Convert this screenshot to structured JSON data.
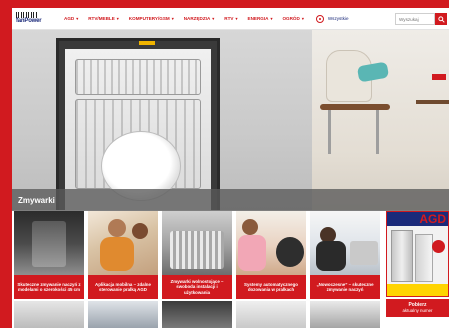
{
  "header": {
    "logo_text": "fanPower",
    "nav_items": [
      {
        "label": "AGD"
      },
      {
        "label": "RTV/MEBLE"
      },
      {
        "label": "KOMPUTERY/GSM"
      },
      {
        "label": "NARZĘDZIA"
      },
      {
        "label": "RTV"
      },
      {
        "label": "ENERGIA"
      },
      {
        "label": "OGRÓD"
      }
    ],
    "user_label": "Wszystkie",
    "search_placeholder": "Wyszukaj",
    "search_icon": "search-icon"
  },
  "hero": {
    "category_title": "Zmywarki"
  },
  "tiles": [
    {
      "caption": "Skuteczne zmywanie naczyń z modelami o szerokości 45 cm"
    },
    {
      "caption": "Aplikacja mobilna – zdalne sterowanie pralką AGD"
    },
    {
      "caption": "Zmywarki wolnostojące – swoboda instalacji i użytkowania"
    },
    {
      "caption": "Systemy automatycznego dozowania w pralkach"
    },
    {
      "caption": "„Nowoczesne” – skuteczne zmywanie naczyń"
    }
  ],
  "magazine": {
    "cover_title": "AGD",
    "link_line1": "Pobierz",
    "link_line2": "aktualny numer"
  },
  "colors": {
    "brand_red": "#d11a1f",
    "brand_navy": "#1b2a7a"
  }
}
